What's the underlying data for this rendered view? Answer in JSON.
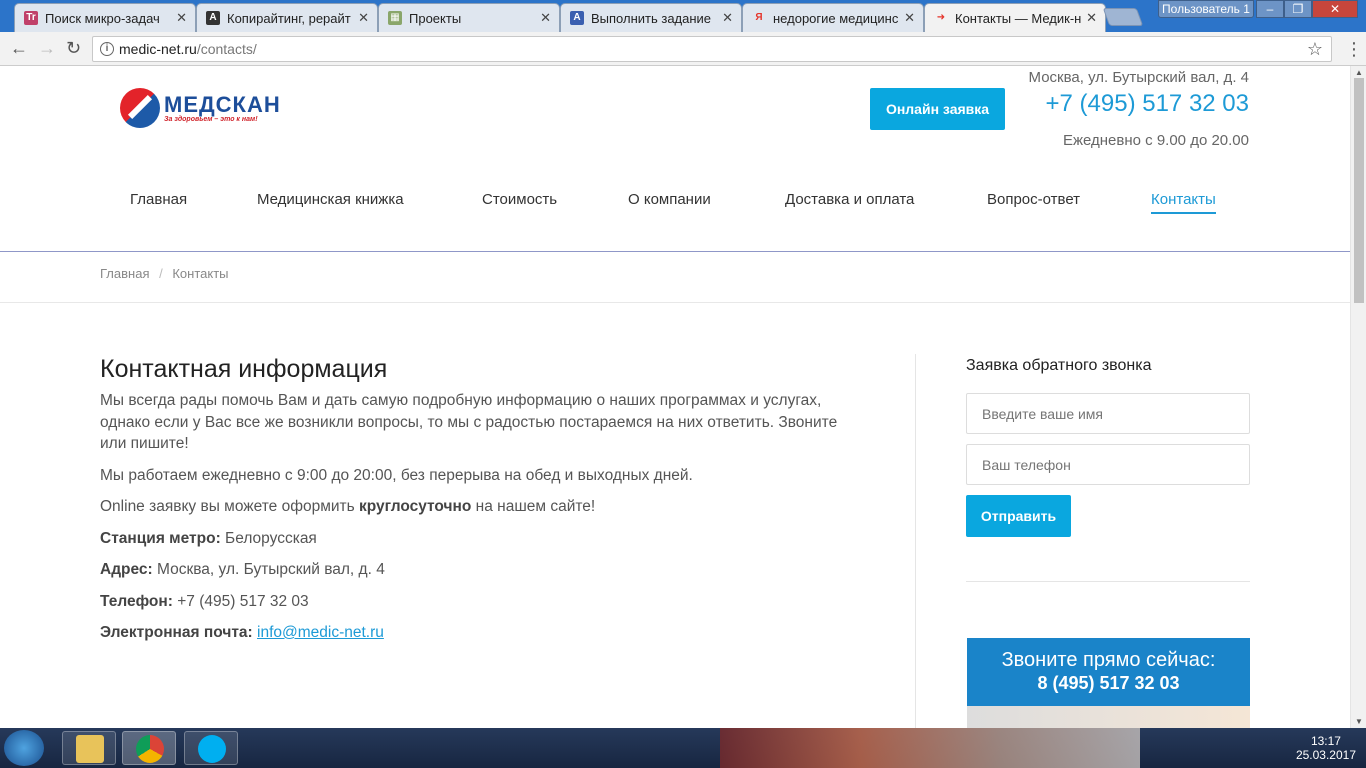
{
  "browser": {
    "tabs": [
      {
        "title": "Поиск микро-задач",
        "fav": "Tr",
        "fav_color": "#c0406a"
      },
      {
        "title": "Копирайтинг, рерайт",
        "fav": "A",
        "fav_color": "#333333"
      },
      {
        "title": "Проекты",
        "fav": "▦",
        "fav_color": "#8aa66a"
      },
      {
        "title": "Выполнить задание",
        "fav": "A",
        "fav_color": "#3a5fb0"
      },
      {
        "title": "недорогие медицинс",
        "fav": "Я",
        "fav_color": "#e5352b"
      },
      {
        "title": "Контакты — Медик-н",
        "fav": "➜",
        "fav_color": "#e5352b"
      }
    ],
    "user": "Пользователь 1",
    "url_host": "medic-net.ru",
    "url_path": "/contacts/"
  },
  "header": {
    "logo_name": "МЕДСКАН",
    "logo_slogan": "За здоровьем – это к нам!",
    "online_button": "Онлайн заявка",
    "address": "Москва, ул. Бутырский вал, д. 4",
    "phone": "+7 (495) 517 32 03",
    "hours": "Ежедневно с 9.00 до 20.00"
  },
  "nav": [
    "Главная",
    "Медицинская книжка",
    "Стоимость",
    "О компании",
    "Доставка и оплата",
    "Вопрос-ответ",
    "Контакты"
  ],
  "breadcrumb": {
    "home": "Главная",
    "sep": "/",
    "current": "Контакты"
  },
  "content": {
    "title": "Контактная информация",
    "p1": "Мы всегда рады помочь Вам и дать самую подробную информацию о наших программах и услугах, однако если у Вас все же возникли вопросы, то мы с радостью постараемся на них ответить. Звоните или пишите!",
    "p2": "Мы работаем ежедневно с 9:00 до 20:00, без перерыва на обед и выходных дней.",
    "p3_a": "Online заявку вы можете оформить ",
    "p3_b": "круглосуточно",
    "p3_c": " на нашем сайте!",
    "metro_label": "Станция метро:",
    "metro_value": " Белорусская",
    "addr_label": "Адрес:",
    "addr_value": " Москва, ул. Бутырский вал, д. 4",
    "phone_label": "Телефон:",
    "phone_value": " +7 (495) 517 32 03",
    "email_label": "Электронная почта:",
    "email_value": "info@medic-net.ru"
  },
  "sidebar": {
    "title": "Заявка обратного звонка",
    "name_placeholder": "Введите ваше имя",
    "phone_placeholder": "Ваш телефон",
    "send": "Отправить",
    "banner_l1": "Звоните прямо сейчас:",
    "banner_l2": "8 (495) 517 32 03"
  },
  "taskbar": {
    "time": "13:17",
    "date": "25.03.2017"
  }
}
